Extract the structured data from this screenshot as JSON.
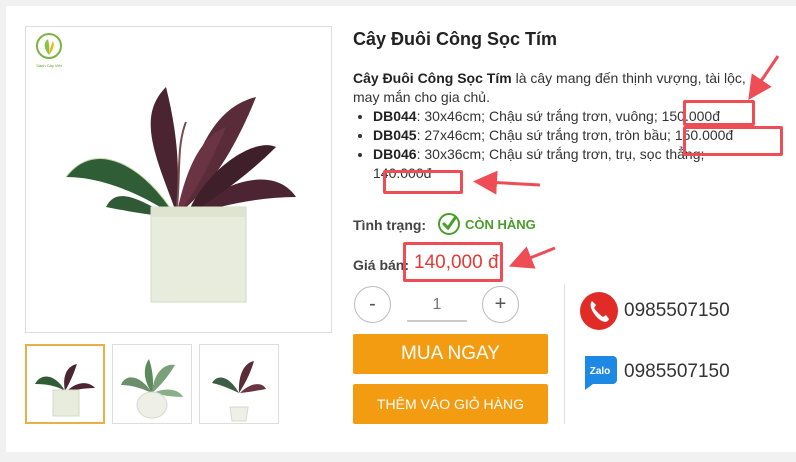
{
  "product": {
    "title": "Cây Đuôi Công Sọc Tím",
    "desc_bold": "Cây Đuôi Công Sọc Tím",
    "desc_text": " là cây mang đến thịnh vượng, tài lộc, may mắn cho gia chủ.",
    "variants": [
      {
        "code": "DB044",
        "text": ": 30x46cm; Chậu sứ trắng trơn, vuông; ",
        "price": "150.000đ"
      },
      {
        "code": "DB045",
        "text": ": 27x46cm; Chậu sứ trắng trơn, tròn bầu; ",
        "price": "150.000đ"
      },
      {
        "code": "DB046",
        "text": ": 30x36cm; Chậu sứ trắng trơn, trụ, sọc thẳng; ",
        "price": "140.000đ"
      }
    ],
    "status_label": "Tình trạng:",
    "stock_text": "CÒN HÀNG",
    "price_label": "Giá bán:",
    "price": "140,000 đ"
  },
  "quantity": {
    "minus": "-",
    "value": "1",
    "plus": "+"
  },
  "buttons": {
    "buy": "MUA NGAY",
    "add_to_cart": "THÊM VÀO GIỎ HÀNG"
  },
  "contacts": {
    "phone": "0985507150",
    "zalo": "0985507150",
    "zalo_label": "Zalo"
  },
  "logo_text": "Sành Cây Việt",
  "colors": {
    "accent": "#f39c12",
    "price": "#e53935",
    "stock": "#4a9d2b",
    "annotation": "#ee4d55"
  }
}
